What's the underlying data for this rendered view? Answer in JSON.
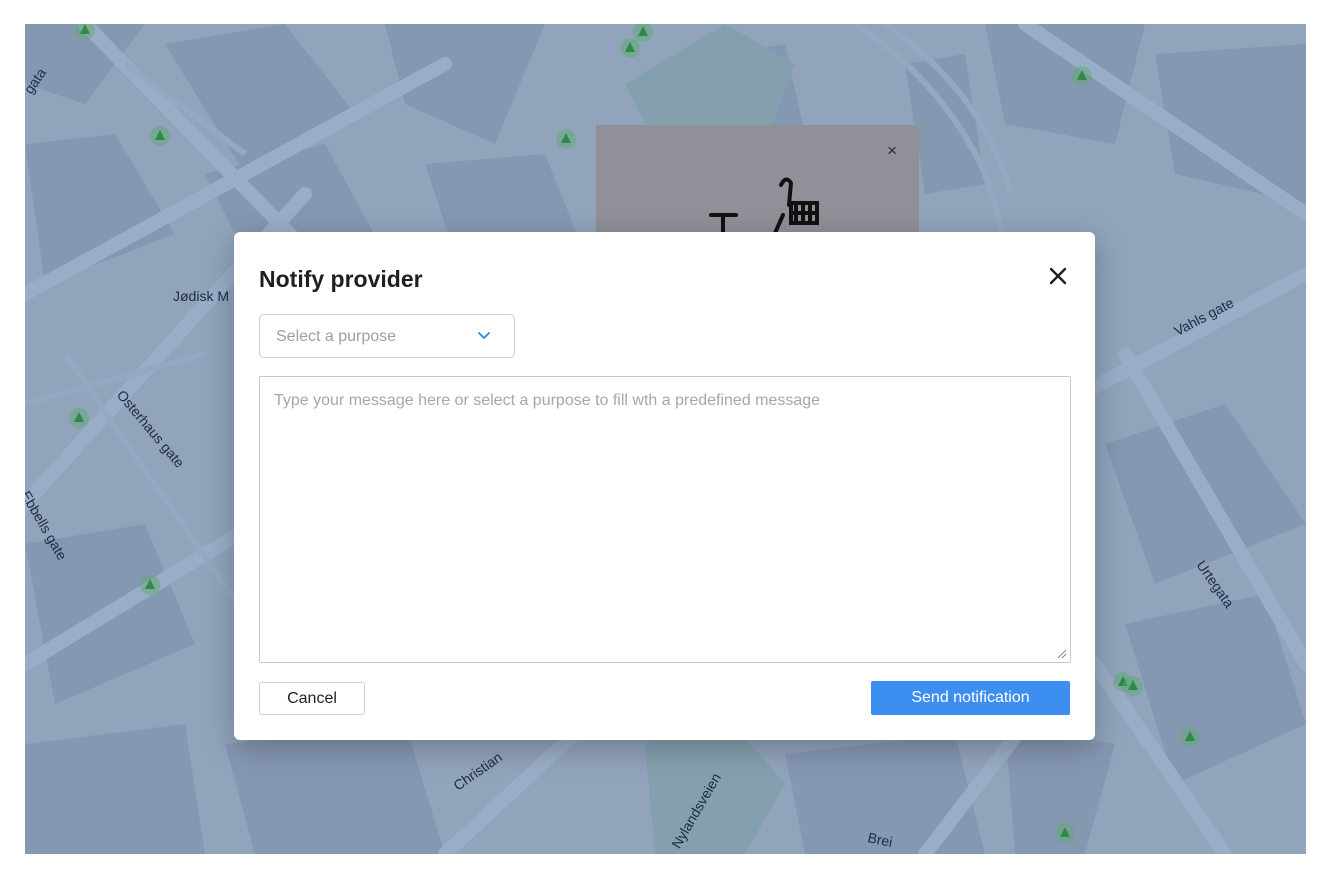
{
  "map": {
    "street_labels": [
      "Vahls gate",
      "Osterhaus gate",
      "Ebbells gate",
      "Urtegata",
      "Christian",
      "Nylandsveien",
      "Brei",
      "Jødisk M",
      "gata"
    ]
  },
  "background_popup": {
    "close_glyph": "×",
    "image_icon": "bike-icon"
  },
  "modal": {
    "title": "Notify provider",
    "close_icon": "close-icon",
    "purpose_select": {
      "placeholder": "Select a purpose",
      "icon": "chevron-down-icon"
    },
    "message": {
      "placeholder": "Type your message here or select a purpose to fill wth a predefined message",
      "value": ""
    },
    "cancel_label": "Cancel",
    "send_label": "Send notification"
  },
  "colors": {
    "accent": "#3d8ef1",
    "map_overlay": "#2855964d"
  }
}
